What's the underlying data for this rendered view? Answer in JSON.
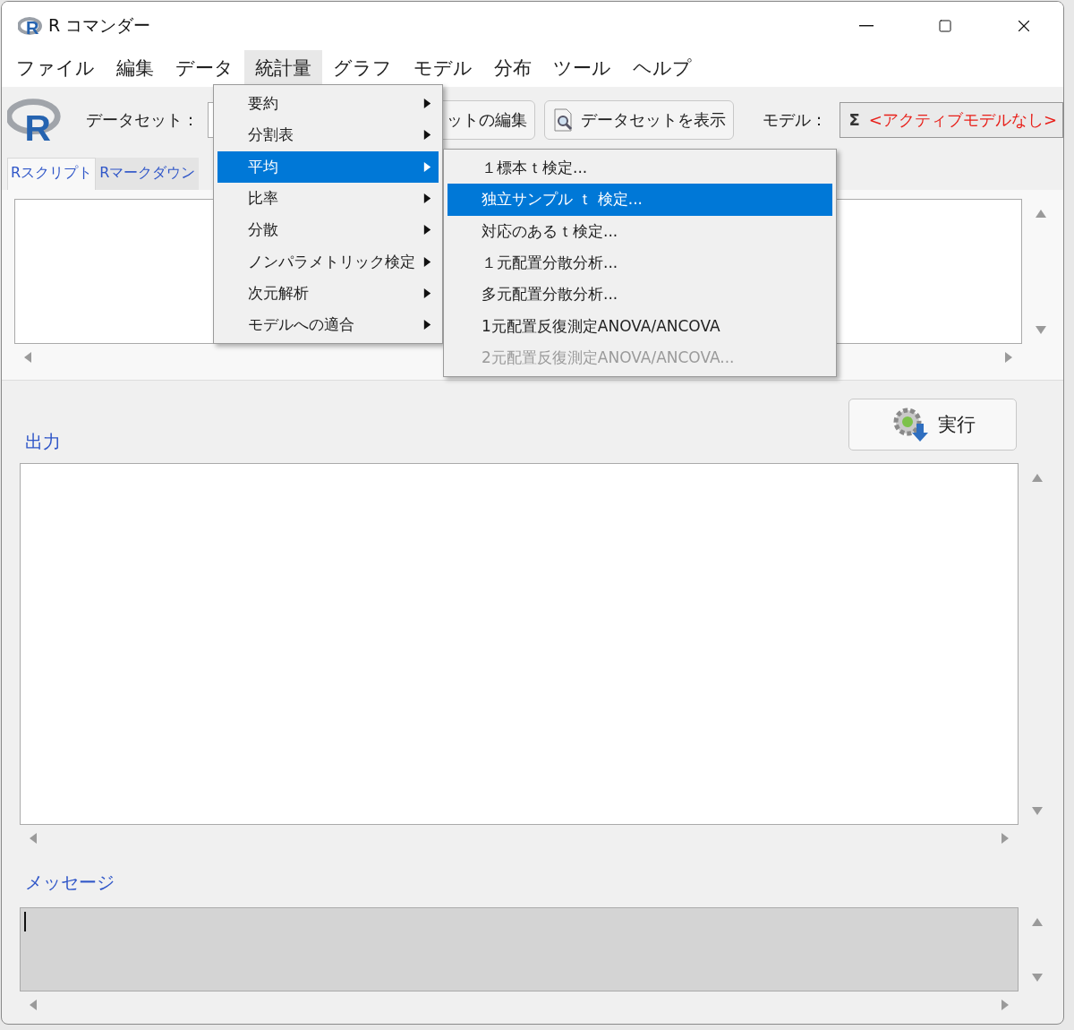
{
  "window": {
    "title": "R コマンダー",
    "icon_letter": "R"
  },
  "menu_bar": [
    {
      "label": "ファイル",
      "selected": false
    },
    {
      "label": "編集",
      "selected": false
    },
    {
      "label": "データ",
      "selected": false
    },
    {
      "label": "統計量",
      "selected": true
    },
    {
      "label": "グラフ",
      "selected": false
    },
    {
      "label": "モデル",
      "selected": false
    },
    {
      "label": "分布",
      "selected": false
    },
    {
      "label": "ツール",
      "selected": false
    },
    {
      "label": "ヘルプ",
      "selected": false
    }
  ],
  "toolbar": {
    "logo_letter": "R",
    "dataset_label": "データセット：",
    "edit_button": "ットの編集",
    "view_button": "データセットを表示",
    "model_label": "モデル：",
    "model_symbol": "Σ",
    "model_value": "<アクティブモデルなし>"
  },
  "tabs": [
    {
      "label": "Rスクリプト",
      "selected": true
    },
    {
      "label": "Rマークダウン",
      "selected": false
    }
  ],
  "run_button": "実行",
  "output": {
    "label": "出力"
  },
  "messages": {
    "label": "メッセージ"
  },
  "menu": {
    "items": [
      {
        "label": "要約",
        "selected": false
      },
      {
        "label": "分割表",
        "selected": false
      },
      {
        "label": "平均",
        "selected": true
      },
      {
        "label": "比率",
        "selected": false
      },
      {
        "label": "分散",
        "selected": false
      },
      {
        "label": "ノンパラメトリック検定",
        "selected": false
      },
      {
        "label": "次元解析",
        "selected": false
      },
      {
        "label": "モデルへの適合",
        "selected": false
      }
    ]
  },
  "submenu": {
    "items": [
      {
        "label": "１標本ｔ検定...",
        "selected": false,
        "disabled": false
      },
      {
        "label": "独立サンプル ｔ 検定...",
        "selected": true,
        "disabled": false
      },
      {
        "label": "対応のあるｔ検定...",
        "selected": false,
        "disabled": false
      },
      {
        "label": "１元配置分散分析...",
        "selected": false,
        "disabled": false
      },
      {
        "label": "多元配置分散分析...",
        "selected": false,
        "disabled": false
      },
      {
        "label": "1元配置反復測定ANOVA/ANCOVA",
        "selected": false,
        "disabled": false
      },
      {
        "label": "2元配置反復測定ANOVA/ANCOVA...",
        "selected": false,
        "disabled": true
      }
    ]
  }
}
